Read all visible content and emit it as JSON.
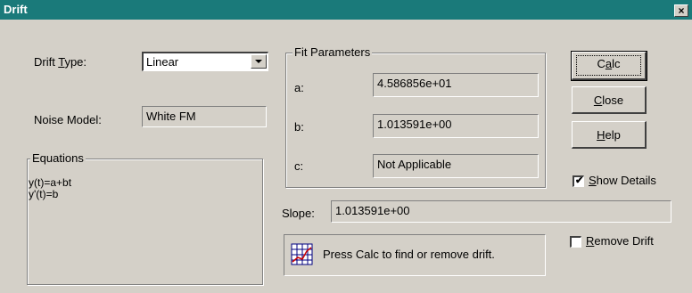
{
  "window": {
    "title": "Drift",
    "close_glyph": "×"
  },
  "drift_type": {
    "label_pre": "Drift ",
    "label_key": "T",
    "label_post": "ype:",
    "selected": "Linear"
  },
  "noise_model": {
    "label": "Noise Model:",
    "value": "White FM"
  },
  "equations": {
    "legend": "Equations",
    "lines": [
      "y(t)=a+bt",
      "y'(t)=b"
    ]
  },
  "fit_parameters": {
    "legend": "Fit Parameters",
    "params": [
      {
        "label": "a:",
        "value": "4.586856e+01"
      },
      {
        "label": "b:",
        "value": "1.013591e+00"
      },
      {
        "label": "c:",
        "value": "Not Applicable"
      }
    ]
  },
  "slope": {
    "label": "Slope:",
    "value": "1.013591e+00"
  },
  "status": {
    "message": "Press Calc to find or remove drift.",
    "icon": "chart-grid-icon"
  },
  "buttons": {
    "calc": {
      "pre": "C",
      "key": "a",
      "post": "lc"
    },
    "close": {
      "pre": "",
      "key": "C",
      "post": "lose"
    },
    "help": {
      "pre": "",
      "key": "H",
      "post": "elp"
    }
  },
  "show_details": {
    "key": "S",
    "post": "how Details",
    "checked": true,
    "check_glyph": "✔"
  },
  "remove_drift": {
    "key": "R",
    "post": "emove Drift",
    "checked": false
  },
  "colors": {
    "titlebar": "#1a7a7a",
    "face": "#d4d0c8"
  }
}
